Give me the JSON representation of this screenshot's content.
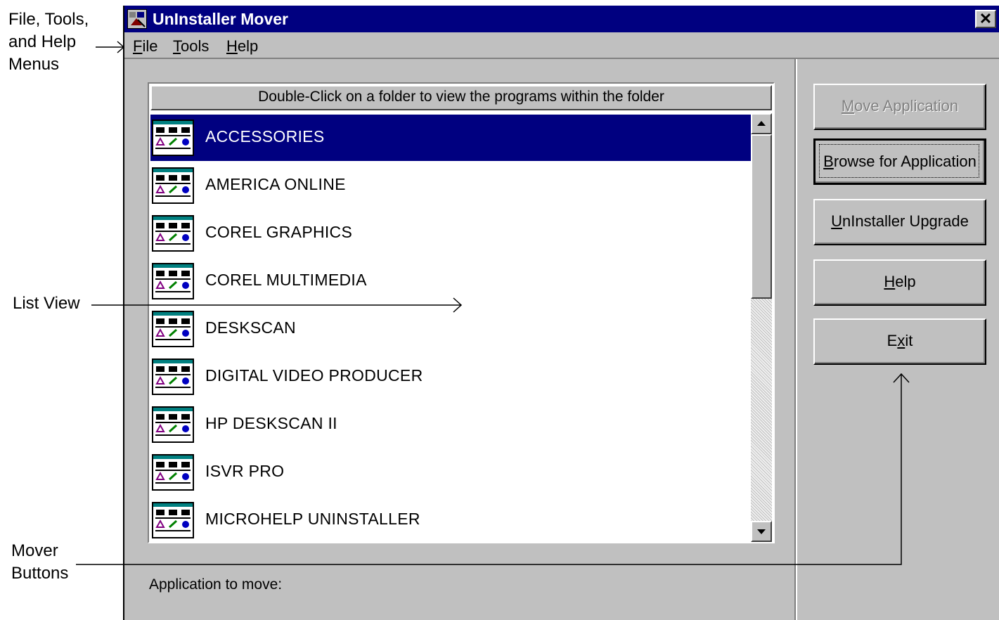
{
  "annotations": {
    "menus_line1": "File, Tools,",
    "menus_line2": "and Help",
    "menus_line3": "Menus",
    "list_view": "List View",
    "mover_line1": "Mover",
    "mover_line2": "Buttons"
  },
  "window": {
    "title": "UnInstaller Mover",
    "close_glyph": "✕"
  },
  "menu": {
    "file": {
      "mnemonic": "F",
      "rest": "ile"
    },
    "tools": {
      "mnemonic": "T",
      "rest": "ools"
    },
    "help": {
      "mnemonic": "H",
      "rest": "elp"
    }
  },
  "list": {
    "header": "Double-Click on a folder to view the programs within the folder",
    "items": [
      {
        "label": "ACCESSORIES",
        "selected": true
      },
      {
        "label": "AMERICA ONLINE"
      },
      {
        "label": "COREL GRAPHICS"
      },
      {
        "label": "COREL MULTIMEDIA"
      },
      {
        "label": "DESKSCAN"
      },
      {
        "label": "DIGITAL VIDEO PRODUCER"
      },
      {
        "label": "HP DESKSCAN II"
      },
      {
        "label": "ISVR PRO"
      },
      {
        "label": "MICROHELP UNINSTALLER"
      }
    ],
    "item_icon": "program-group-icon"
  },
  "buttons": {
    "move": {
      "mnemonic": "M",
      "rest": "ove Application",
      "enabled": false
    },
    "browse": {
      "mnemonic": "B",
      "rest": "rowse for Application",
      "default": true
    },
    "upgrade": {
      "mnemonic": "U",
      "rest": "nInstaller Upgrade"
    },
    "help": {
      "mnemonic": "H",
      "rest": "elp"
    },
    "exit": {
      "before": "E",
      "mnemonic": "x",
      "rest": "it"
    }
  },
  "status": {
    "label": "Application to move:"
  },
  "colors": {
    "titlebar": "#000080",
    "face": "#c0c0c0",
    "selection": "#000080"
  }
}
